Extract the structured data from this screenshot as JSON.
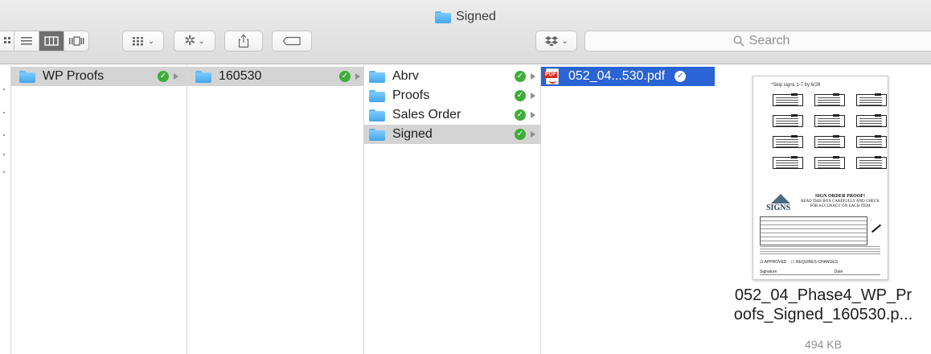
{
  "window": {
    "title": "Signed"
  },
  "toolbar": {
    "view_buttons": [
      "icon-view",
      "list-view",
      "column-view",
      "coverflow-view"
    ],
    "active_view": "column-view",
    "arrange_icon": "grid-icon",
    "action_icon": "gear-icon",
    "share_icon": "share-icon",
    "tag_icon": "tag-icon",
    "dropbox_icon": "dropbox-icon",
    "search_placeholder": "Search"
  },
  "columns": [
    {
      "items": [
        {
          "label": "WP Proofs",
          "selected": true,
          "synced": true
        }
      ]
    },
    {
      "items": [
        {
          "label": "160530",
          "selected": true,
          "synced": true
        }
      ]
    },
    {
      "items": [
        {
          "label": "Abrv",
          "synced": true
        },
        {
          "label": "Proofs",
          "synced": true
        },
        {
          "label": "Sales Order",
          "synced": true
        },
        {
          "label": "Signed",
          "synced": true,
          "selected": true
        }
      ]
    },
    {
      "items": [
        {
          "label": "052_04...530.pdf",
          "synced": true,
          "selected": true,
          "type": "pdf"
        }
      ]
    }
  ],
  "preview": {
    "thumb_caption": "*Skip signs 1-7 by 6/26",
    "thumb_heading": "SIGN ORDER PROOF!",
    "thumb_subheading": "READ THIS BOX CAREFULLY AND CHECK FOR ACCURACY ON EACH ITEM",
    "thumb_logo": "SIGNS",
    "thumb_approved": "APPROVED",
    "thumb_requires": "REQUIRES CHANGES",
    "thumb_signature": "Signature",
    "thumb_date": "Date",
    "filename_line1": "052_04_Phase4_WP_Pr",
    "filename_line2": "oofs_Signed_160530.p...",
    "size": "494 KB"
  },
  "colors": {
    "selection_blue": "#2a63d4",
    "selection_gray": "#d4d4d4",
    "sync_green": "#3fae3a",
    "folder_blue": "#5cb5f0"
  }
}
